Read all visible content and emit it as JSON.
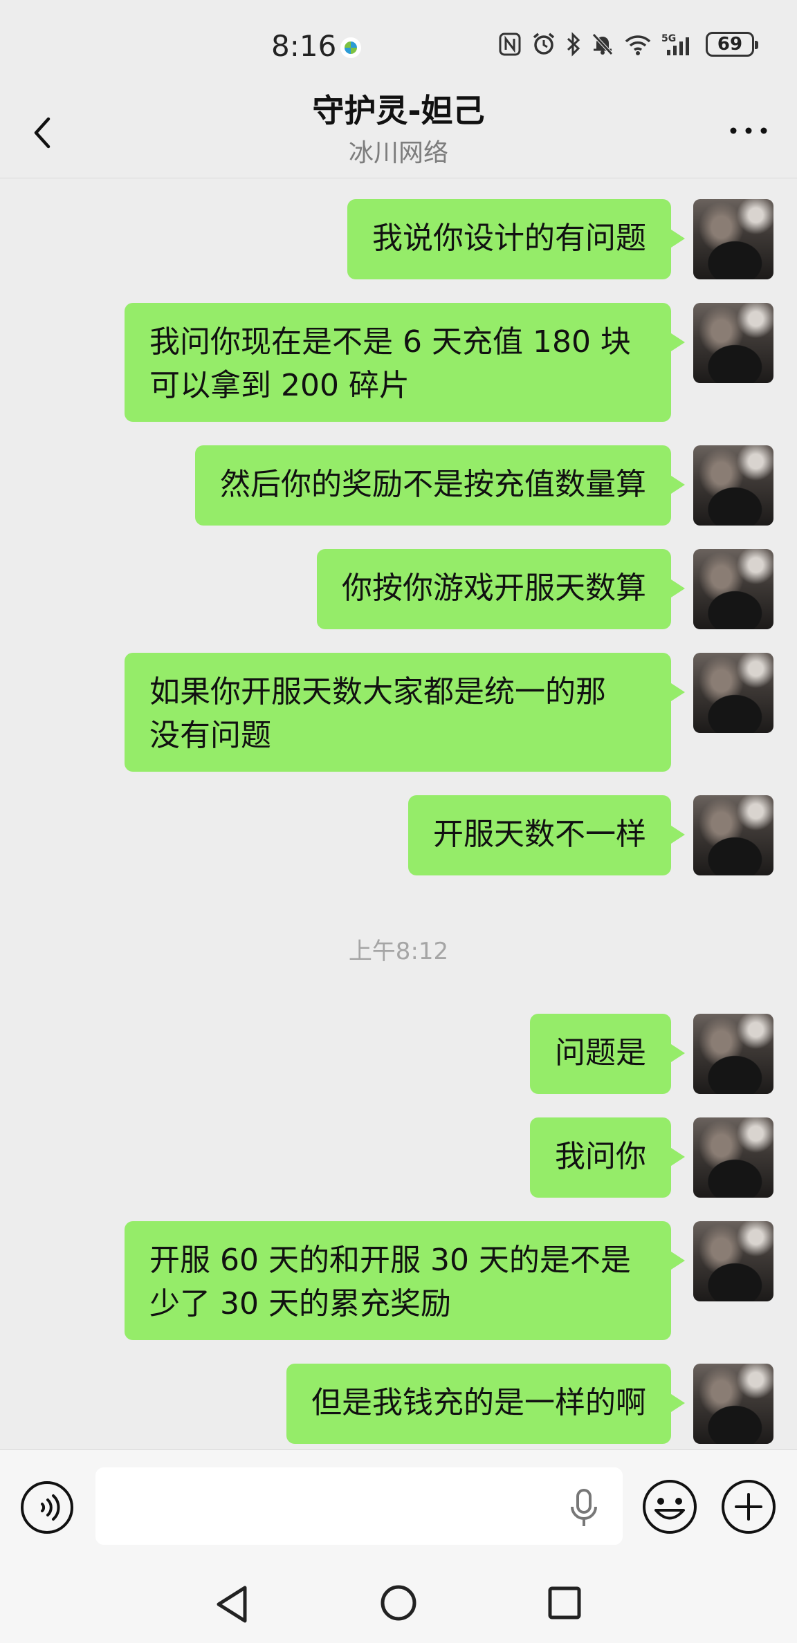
{
  "status_bar": {
    "time": "8:16",
    "battery": "69",
    "network": "5G"
  },
  "header": {
    "title": "守护灵-妲己",
    "subtitle": "冰川网络"
  },
  "messages": [
    {
      "text": "我说你设计的有问题"
    },
    {
      "text": "我问你现在是不是 6 天充值 180 块\n可以拿到 200 碎片"
    },
    {
      "text": "然后你的奖励不是按充值数量算"
    },
    {
      "text": "你按你游戏开服天数算"
    },
    {
      "text": "如果你开服天数大家都是统一的那\n没有问题"
    },
    {
      "text": "开服天数不一样"
    },
    {
      "text": "问题是"
    },
    {
      "text": "我问你"
    },
    {
      "text": "开服 60 天的和开服 30 天的是不是\n少了 30 天的累充奖励"
    },
    {
      "text": "但是我钱充的是一样的啊"
    }
  ],
  "timestamp": "上午8:12",
  "input": {
    "placeholder": ""
  },
  "colors": {
    "bubble": "#95ec69",
    "background": "#ededed"
  }
}
